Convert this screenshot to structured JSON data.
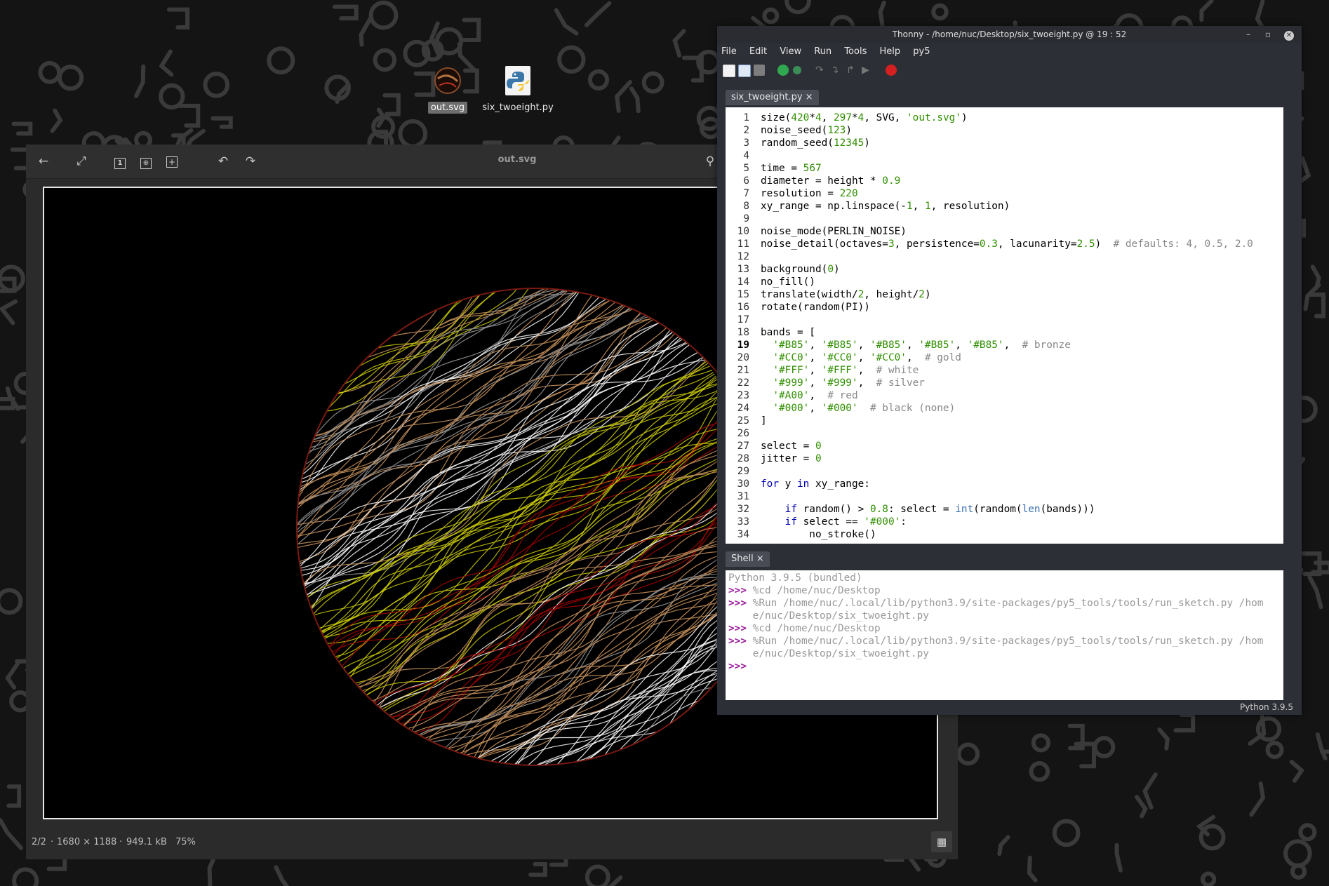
{
  "desktop": {
    "icons": [
      {
        "label": "out.svg",
        "selected": true,
        "icon": "svg-image-icon"
      },
      {
        "label": "six_twoeight.py",
        "selected": false,
        "icon": "python-file-icon"
      }
    ]
  },
  "viewer": {
    "title": "out.svg",
    "toolbar": [
      "back-arrow-icon",
      "fullscreen-icon",
      "actual-size-icon",
      "fit-window-icon",
      "zoom-in-icon",
      "rotate-left-icon",
      "rotate-right-icon",
      "light-bulb-icon"
    ],
    "status": {
      "position": "2/2",
      "dimensions": "1680 × 1188",
      "filesize": "949.1 kB",
      "zoom": "75%"
    },
    "artwork_colors": [
      "#B85",
      "#CC0",
      "#FFF",
      "#999",
      "#A00"
    ]
  },
  "thonny": {
    "title": "Thonny  -  /home/nuc/Desktop/six_twoeight.py  @  19 : 52",
    "menu": [
      "File",
      "Edit",
      "View",
      "Run",
      "Tools",
      "Help",
      "py5"
    ],
    "editor_tab": "six_twoeight.py ×",
    "current_line": 19,
    "code": [
      {
        "n": 1,
        "text": "size(420*4, 297*4, SVG, 'out.svg')"
      },
      {
        "n": 2,
        "text": "noise_seed(123)"
      },
      {
        "n": 3,
        "text": "random_seed(12345)"
      },
      {
        "n": 4,
        "text": ""
      },
      {
        "n": 5,
        "text": "time = 567"
      },
      {
        "n": 6,
        "text": "diameter = height * 0.9"
      },
      {
        "n": 7,
        "text": "resolution = 220"
      },
      {
        "n": 8,
        "text": "xy_range = np.linspace(-1, 1, resolution)"
      },
      {
        "n": 9,
        "text": ""
      },
      {
        "n": 10,
        "text": "noise_mode(PERLIN_NOISE)"
      },
      {
        "n": 11,
        "text": "noise_detail(octaves=3, persistence=0.3, lacunarity=2.5)  # defaults: 4, 0.5, 2.0"
      },
      {
        "n": 12,
        "text": ""
      },
      {
        "n": 13,
        "text": "background(0)"
      },
      {
        "n": 14,
        "text": "no_fill()"
      },
      {
        "n": 15,
        "text": "translate(width/2, height/2)"
      },
      {
        "n": 16,
        "text": "rotate(random(PI))"
      },
      {
        "n": 17,
        "text": ""
      },
      {
        "n": 18,
        "text": "bands = ["
      },
      {
        "n": 19,
        "text": "  '#B85', '#B85', '#B85', '#B85', '#B85',  # bronze"
      },
      {
        "n": 20,
        "text": "  '#CC0', '#CC0', '#CC0',  # gold"
      },
      {
        "n": 21,
        "text": "  '#FFF', '#FFF',  # white"
      },
      {
        "n": 22,
        "text": "  '#999', '#999',  # silver"
      },
      {
        "n": 23,
        "text": "  '#A00',  # red"
      },
      {
        "n": 24,
        "text": "  '#000', '#000'  # black (none)"
      },
      {
        "n": 25,
        "text": "]"
      },
      {
        "n": 26,
        "text": ""
      },
      {
        "n": 27,
        "text": "select = 0"
      },
      {
        "n": 28,
        "text": "jitter = 0"
      },
      {
        "n": 29,
        "text": ""
      },
      {
        "n": 30,
        "text": "for y in xy_range:"
      },
      {
        "n": 31,
        "text": ""
      },
      {
        "n": 32,
        "text": "    if random() > 0.8: select = int(random(len(bands)))"
      },
      {
        "n": 33,
        "text": "    if select == '#000':"
      },
      {
        "n": 34,
        "text": "        no_stroke()"
      }
    ],
    "shell_tab": "Shell ×",
    "shell": [
      {
        "prompt": "",
        "text": "Python 3.9.5 (bundled)"
      },
      {
        "prompt": ">>>",
        "text": " %cd /home/nuc/Desktop"
      },
      {
        "prompt": ">>>",
        "text": " %Run /home/nuc/.local/lib/python3.9/site-packages/py5_tools/tools/run_sketch.py /hom"
      },
      {
        "prompt": "",
        "text": "    e/nuc/Desktop/six_twoeight.py"
      },
      {
        "prompt": ">>>",
        "text": " %cd /home/nuc/Desktop"
      },
      {
        "prompt": ">>>",
        "text": " %Run /home/nuc/.local/lib/python3.9/site-packages/py5_tools/tools/run_sketch.py /hom"
      },
      {
        "prompt": "",
        "text": "    e/nuc/Desktop/six_twoeight.py"
      },
      {
        "prompt": ">>>",
        "text": ""
      }
    ],
    "status": "Python 3.9.5"
  }
}
